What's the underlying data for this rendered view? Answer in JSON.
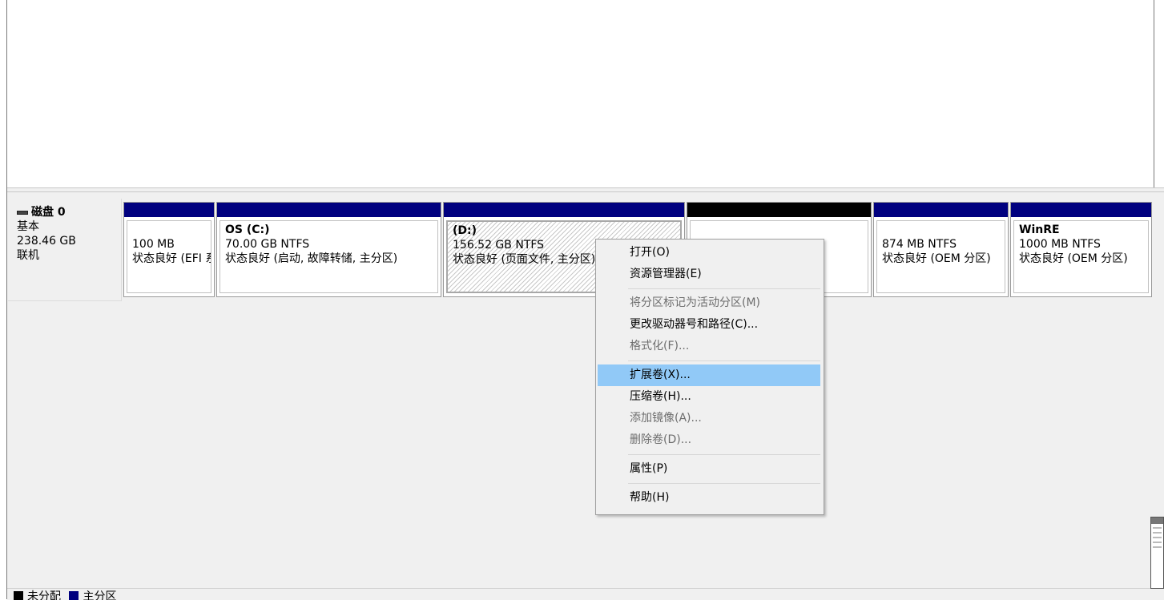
{
  "disk": {
    "name": "磁盘 0",
    "type": "基本",
    "size": "238.46 GB",
    "status": "联机"
  },
  "partitions": [
    {
      "name": "",
      "size_fs": "100 MB",
      "status": "状态良好 (EFI 系统分区)"
    },
    {
      "name": "OS  (C:)",
      "size_fs": "70.00 GB NTFS",
      "status": "状态良好 (启动, 故障转储, 主分区)"
    },
    {
      "name": "(D:)",
      "size_fs": "156.52 GB NTFS",
      "status": "状态良好 (页面文件, 主分区)"
    },
    {
      "name": "",
      "size_fs": "",
      "status": ""
    },
    {
      "name": "",
      "size_fs": "874 MB NTFS",
      "status": "状态良好 (OEM 分区)"
    },
    {
      "name": "WinRE",
      "size_fs": "1000 MB NTFS",
      "status": "状态良好 (OEM 分区)"
    }
  ],
  "context_menu": {
    "open": "打开(O)",
    "explorer": "资源管理器(E)",
    "mark_active": "将分区标记为活动分区(M)",
    "change_letter": "更改驱动器号和路径(C)...",
    "format": "格式化(F)...",
    "extend": "扩展卷(X)...",
    "shrink": "压缩卷(H)...",
    "add_mirror": "添加镜像(A)...",
    "delete": "删除卷(D)...",
    "properties": "属性(P)",
    "help": "帮助(H)"
  },
  "legend": {
    "unallocated": "未分配",
    "primary": "主分区"
  },
  "colors": {
    "primary_partition": "#00007f",
    "unallocated": "#000000",
    "menu_highlight": "#91c9f7"
  }
}
